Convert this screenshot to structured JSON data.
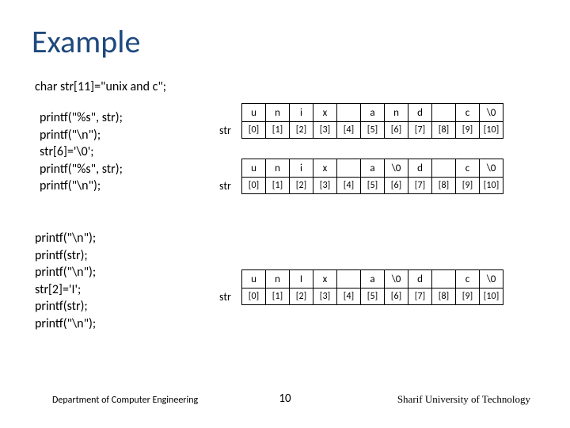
{
  "title": "Example",
  "decl": "char str[11]=\"unix and c\";",
  "code1": "printf(\"%s\", str);\nprintf(\"\\n\");\nstr[6]='\\0';\nprintf(\"%s\", str);\nprintf(\"\\n\");",
  "code2": "printf(\"\\n\");\nprintf(str);\nprintf(\"\\n\");\nstr[2]='I';\nprintf(str);\nprintf(\"\\n\");",
  "arrayLabel": "str",
  "tables": [
    {
      "values": [
        "u",
        "n",
        "i",
        "x",
        "",
        "a",
        "n",
        "d",
        "",
        "c",
        "\\0"
      ],
      "indices": [
        "[0]",
        "[1]",
        "[2]",
        "[3]",
        "[4]",
        "[5]",
        "[6]",
        "[7]",
        "[8]",
        "[9]",
        "[10]"
      ]
    },
    {
      "values": [
        "u",
        "n",
        "i",
        "x",
        "",
        "a",
        "\\0",
        "d",
        "",
        "c",
        "\\0"
      ],
      "indices": [
        "[0]",
        "[1]",
        "[2]",
        "[3]",
        "[4]",
        "[5]",
        "[6]",
        "[7]",
        "[8]",
        "[9]",
        "[10]"
      ]
    },
    {
      "values": [
        "u",
        "n",
        "I",
        "x",
        "",
        "a",
        "\\0",
        "d",
        "",
        "c",
        "\\0"
      ],
      "indices": [
        "[0]",
        "[1]",
        "[2]",
        "[3]",
        "[4]",
        "[5]",
        "[6]",
        "[7]",
        "[8]",
        "[9]",
        "[10]"
      ]
    }
  ],
  "footer": {
    "left": "Department of Computer Engineering",
    "center": "10",
    "right": "Sharif University of Technology"
  }
}
